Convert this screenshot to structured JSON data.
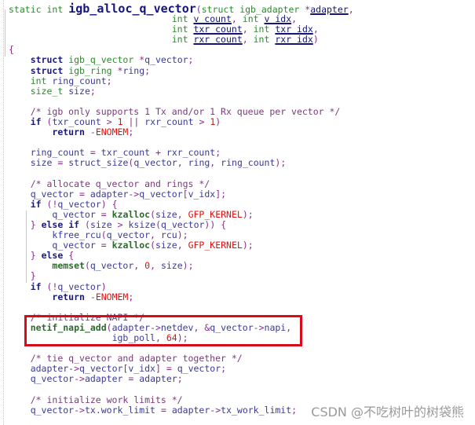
{
  "editor": {
    "language": "C",
    "highlight_color": "#d80c18",
    "lines": [
      {
        "indent": "",
        "text": "static int igb_alloc_q_vector(struct igb_adapter *adapter,"
      },
      {
        "indent": "                              ",
        "text": "int v_count, int v_idx,"
      },
      {
        "indent": "                              ",
        "text": "int txr_count, int txr_idx,"
      },
      {
        "indent": "                              ",
        "text": "int rxr_count, int rxr_idx)"
      },
      {
        "indent": "",
        "text": "{"
      },
      {
        "indent": "    ",
        "text": "struct igb_q_vector *q_vector;"
      },
      {
        "indent": "    ",
        "text": "struct igb_ring *ring;"
      },
      {
        "indent": "    ",
        "text": "int ring_count;"
      },
      {
        "indent": "    ",
        "text": "size_t size;"
      },
      {
        "indent": "",
        "text": ""
      },
      {
        "indent": "    ",
        "text": "/* igb only supports 1 Tx and/or 1 Rx queue per vector */"
      },
      {
        "indent": "    ",
        "text": "if (txr_count > 1 || rxr_count > 1)"
      },
      {
        "indent": "        ",
        "text": "return -ENOMEM;"
      },
      {
        "indent": "",
        "text": ""
      },
      {
        "indent": "    ",
        "text": "ring_count = txr_count + rxr_count;"
      },
      {
        "indent": "    ",
        "text": "size = struct_size(q_vector, ring, ring_count);"
      },
      {
        "indent": "",
        "text": ""
      },
      {
        "indent": "    ",
        "text": "/* allocate q_vector and rings */"
      },
      {
        "indent": "    ",
        "text": "q_vector = adapter->q_vector[v_idx];"
      },
      {
        "indent": "    ",
        "text": "if (!q_vector) {"
      },
      {
        "indent": "        ",
        "text": "q_vector = kzalloc(size, GFP_KERNEL);"
      },
      {
        "indent": "    ",
        "text": "} else if (size > ksize(q_vector)) {"
      },
      {
        "indent": "        ",
        "text": "kfree_rcu(q_vector, rcu);"
      },
      {
        "indent": "        ",
        "text": "q_vector = kzalloc(size, GFP_KERNEL);"
      },
      {
        "indent": "    ",
        "text": "} else {"
      },
      {
        "indent": "        ",
        "text": "memset(q_vector, 0, size);"
      },
      {
        "indent": "    ",
        "text": "}"
      },
      {
        "indent": "    ",
        "text": "if (!q_vector)"
      },
      {
        "indent": "        ",
        "text": "return -ENOMEM;"
      },
      {
        "indent": "",
        "text": ""
      },
      {
        "indent": "    ",
        "text": "/* initialize NAPI */"
      },
      {
        "indent": "    ",
        "text": "netif_napi_add(adapter->netdev, &q_vector->napi,"
      },
      {
        "indent": "                   ",
        "text": "igb_poll, 64);"
      },
      {
        "indent": "",
        "text": ""
      },
      {
        "indent": "    ",
        "text": "/* tie q_vector and adapter together */"
      },
      {
        "indent": "    ",
        "text": "adapter->q_vector[v_idx] = q_vector;"
      },
      {
        "indent": "    ",
        "text": "q_vector->adapter = adapter;"
      },
      {
        "indent": "",
        "text": ""
      },
      {
        "indent": "    ",
        "text": "/* initialize work limits */"
      },
      {
        "indent": "    ",
        "text": "q_vector->tx.work_limit = adapter->tx_work_limit;"
      }
    ]
  },
  "watermark": "CSDN @不吃树叶的树袋熊"
}
